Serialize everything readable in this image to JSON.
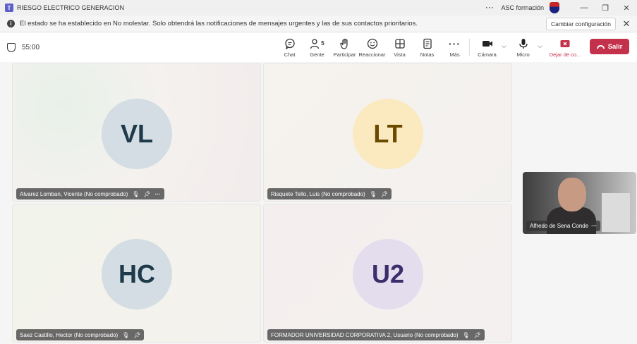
{
  "window": {
    "title": "RIESGO ELECTRICO GENERACION",
    "more": "···",
    "org": "ASC formación",
    "minimize": "—",
    "restore": "❐",
    "close": "✕"
  },
  "notification": {
    "message": "El estado se ha establecido en No molestar. Solo obtendrá las notificaciones de mensajes urgentes y las de sus contactos prioritarios.",
    "change_button": "Cambiar configuración",
    "close": "✕"
  },
  "meeting": {
    "timer": "55:00",
    "tools": [
      {
        "id": "chat",
        "label": "Chat",
        "icon": "chat-icon"
      },
      {
        "id": "gente",
        "label": "Gente",
        "icon": "people-icon",
        "badge": "5"
      },
      {
        "id": "participar",
        "label": "Participar",
        "icon": "raise-hand-icon"
      },
      {
        "id": "reaccionar",
        "label": "Reaccionar",
        "icon": "smiley-icon"
      },
      {
        "id": "vista",
        "label": "Vista",
        "icon": "grid-view-icon"
      },
      {
        "id": "notas",
        "label": "Notas",
        "icon": "notes-icon"
      },
      {
        "id": "mas",
        "label": "Más",
        "icon": "more-icon"
      }
    ],
    "camera_label": "Cámara",
    "mic_label": "Micro",
    "share_label": "Dejar de co...",
    "leave_label": "Salir",
    "colors": {
      "leave": "#c4314b",
      "share": "#c4314b"
    }
  },
  "participants": [
    {
      "initials": "VL",
      "name": "Alvarez Lomban, Vicente (No comprobado)",
      "avatar_bg": "#d3dde3",
      "avatar_fg": "#1f3a4a"
    },
    {
      "initials": "LT",
      "name": "Risquete Tello, Luis (No comprobado)",
      "avatar_bg": "#fbe9c0",
      "avatar_fg": "#6b4a00"
    },
    {
      "initials": "HC",
      "name": "Saez Castillo, Hector (No comprobado)",
      "avatar_bg": "#d3dde3",
      "avatar_fg": "#1f3a4a"
    },
    {
      "initials": "U2",
      "name": "FORMADOR UNIVERSIDAD CORPORATIVA 2, Usuario (No comprobado)",
      "avatar_bg": "#e3ddee",
      "avatar_fg": "#3b2f6b"
    }
  ],
  "self_video": {
    "name": "Alfredo de Sena Conde",
    "more": "···"
  }
}
